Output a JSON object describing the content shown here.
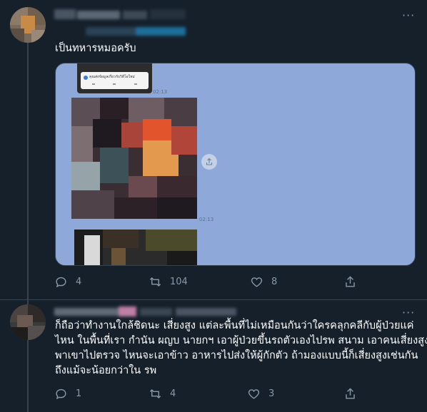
{
  "tweet1": {
    "text": "เป็นทหารหมอครับ",
    "media": {
      "notification_text": "คุณส่งข้อมูลเกี่ยวกับวิดีโอใหม่",
      "timestamps": [
        "02:13",
        "02:13"
      ]
    },
    "actions": {
      "reply_count": "4",
      "retweet_count": "104",
      "like_count": "8"
    }
  },
  "tweet2": {
    "lines": [
      "ก็ถือว่าทำงานใกล้ชิดนะ เสี่ยงสูง แต่ละพื้นที่ไม่เหมือนกันว่าใครคลุกคลีกับผู้ป่วยแค่",
      "ไหน ในพื้นที่เรา กำนัน ผญบ นายกฯ เอาผู้ป่วยขึ้นรถตัวเองไปรพ สนาม เอาคนเสี่ยงสูง",
      "พาเขาไปตรวจ ไหนจะเอาข้าว อาหารไปส่งให้ผู้กักตัว ถ้ามองแบบนี้ก็เสี่ยงสูงเช่นกัน",
      "ถึงแม้จะน้อยกว่าใน รพ"
    ],
    "actions": {
      "reply_count": "1",
      "retweet_count": "4",
      "like_count": "3"
    }
  },
  "icons": [
    "more-icon",
    "reply-icon",
    "retweet-icon",
    "like-icon",
    "share-icon"
  ],
  "colors": {
    "background": "#15202b",
    "muted": "#8899a6",
    "border": "#38444d",
    "media_bg": "#8ea9d9"
  }
}
